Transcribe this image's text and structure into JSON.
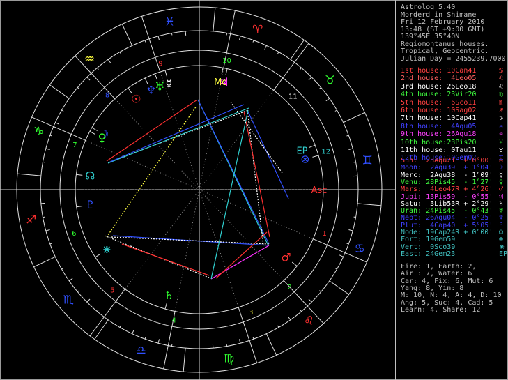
{
  "header": {
    "lines": [
      "Astrolog 5.40",
      "Morderd in Shimane",
      "Fri 12 February 2010",
      "13:48 (ST +9:00 GMT)",
      "139°45E 35°40N",
      "Regiomontanus houses.",
      "Tropical, Geocentric.",
      "Julian Day = 2455239.7000"
    ]
  },
  "houses": [
    {
      "label": "1st house:",
      "value": "10Can41",
      "color": "#ff4040",
      "glyph": "♋"
    },
    {
      "label": "2nd house:",
      "value": " 4Leo05",
      "color": "#ff6060",
      "glyph": "♌"
    },
    {
      "label": "3rd house:",
      "value": "26Leo18",
      "color": "#ffffff",
      "glyph": "♌"
    },
    {
      "label": "4th house:",
      "value": "23Vir20",
      "color": "#40ff40",
      "glyph": "♍"
    },
    {
      "label": "5th house:",
      "value": " 6Sco11",
      "color": "#ff4040",
      "glyph": "♏"
    },
    {
      "label": "6th house:",
      "value": "10Sag02",
      "color": "#ff4040",
      "glyph": "♐"
    },
    {
      "label": "7th house:",
      "value": "10Cap41",
      "color": "#ffffff",
      "glyph": "♑"
    },
    {
      "label": "8th house:",
      "value": " 4Aqu05",
      "color": "#4040ff",
      "glyph": "♒"
    },
    {
      "label": "9th house:",
      "value": "26Aqu18",
      "color": "#ff40ff",
      "glyph": "♒"
    },
    {
      "label": "10th house:",
      "value": "23Pis20",
      "color": "#40ff40",
      "glyph": "♓"
    },
    {
      "label": "11th house:",
      "value": " 0Tau11",
      "color": "#ffffff",
      "glyph": "♉"
    },
    {
      "label": "12th house:",
      "value": "10Gem02",
      "color": "#4040ff",
      "glyph": "♊"
    }
  ],
  "planets": [
    {
      "label": "Sun:",
      "value": "23Aqu21",
      "extra": "+ 0°00'",
      "color": "#ff4040",
      "glyph": "☉"
    },
    {
      "label": "Moon:",
      "value": " 2Aqu39",
      "extra": "+ 1°04'",
      "color": "#4040ff",
      "glyph": "☽"
    },
    {
      "label": "Merc:",
      "value": " 2Aqu38",
      "extra": "- 1°09'",
      "color": "#ffffff",
      "glyph": "☿"
    },
    {
      "label": "Venu:",
      "value": "28Pis45",
      "extra": "- 1°27'",
      "color": "#40ff40",
      "glyph": "♀"
    },
    {
      "label": "Mars:",
      "value": " 4Leo47R",
      "extra": "+ 4°26'",
      "color": "#ff4040",
      "glyph": "♂"
    },
    {
      "label": "Jupi:",
      "value": "13Pis59",
      "extra": "- 0°55'",
      "color": "#ff40ff",
      "glyph": "♃"
    },
    {
      "label": "Satu:",
      "value": " 3Lib53R",
      "extra": "+ 2°29'",
      "color": "#ffffff",
      "glyph": "♄"
    },
    {
      "label": "Uran:",
      "value": "24Pis45",
      "extra": "- 0°43'",
      "color": "#40ff40",
      "glyph": "♅"
    },
    {
      "label": "Nept:",
      "value": "26Aqu04",
      "extra": "- 0°25'",
      "color": "#4040ff",
      "glyph": "♆"
    },
    {
      "label": "Plut:",
      "value": " 4Cap40",
      "extra": "+ 5°05'",
      "color": "#4040ff",
      "glyph": "♇"
    },
    {
      "label": "Node:",
      "value": "19Cap24R",
      "extra": "+ 0°00'",
      "color": "#40c0c0",
      "glyph": "☊"
    },
    {
      "label": "Fort:",
      "value": "19Gem59",
      "extra": "",
      "color": "#40c0c0",
      "glyph": "⊗"
    },
    {
      "label": "Vert:",
      "value": " 0Sco39",
      "extra": "",
      "color": "#40c0c0",
      "glyph": "⋇"
    },
    {
      "label": "East:",
      "value": "24Gem23",
      "extra": "",
      "color": "#40c0c0",
      "glyph": "EP"
    }
  ],
  "summary": [
    "Fire: 1, Earth: 2,",
    "Air : 7, Water: 6",
    "Car: 4, Fix: 6, Mut: 6",
    "Yang: 8, Yin: 8",
    "M: 10, N: 4, A: 4, D: 10",
    "Ang: 5, Suc: 4, Cad: 5",
    "Learn: 4, Share: 12"
  ],
  "colors": {
    "red": "#ff3030",
    "green": "#30ff30",
    "blue": "#3050ff",
    "magenta": "#ff30ff",
    "cyan": "#30d0d0",
    "white": "#ffffff",
    "gray": "#b0b0b0"
  },
  "wheel": {
    "signs": [
      {
        "glyph": "♈",
        "color": "#ff3030",
        "angle": 110
      },
      {
        "glyph": "♉",
        "color": "#30ff30",
        "angle": 140
      },
      {
        "glyph": "♊",
        "color": "#3050ff",
        "angle": 170
      },
      {
        "glyph": "♋",
        "color": "#3050ff",
        "angle": 200
      },
      {
        "glyph": "♌",
        "color": "#ff3030",
        "angle": 230
      },
      {
        "glyph": "♍",
        "color": "#30ff30",
        "angle": 260
      },
      {
        "glyph": "♎",
        "color": "#3050ff",
        "angle": 290
      },
      {
        "glyph": "♏",
        "color": "#3050ff",
        "angle": 320
      },
      {
        "glyph": "♐",
        "color": "#ff3030",
        "angle": 350
      },
      {
        "glyph": "♑",
        "color": "#30ff30",
        "angle": 20
      },
      {
        "glyph": "♒",
        "color": "#ffff40",
        "angle": 50
      },
      {
        "glyph": "♓",
        "color": "#3050ff",
        "angle": 80
      }
    ],
    "house_numbers": [
      {
        "n": "1",
        "color": "#ff3030",
        "angle": 199
      },
      {
        "n": "2",
        "color": "#30ff30",
        "angle": 227
      },
      {
        "n": "3",
        "color": "#ffff40",
        "angle": 247
      },
      {
        "n": "4",
        "color": "#30ff30",
        "angle": 281
      },
      {
        "n": "5",
        "color": "#ff3030",
        "angle": 311
      },
      {
        "n": "6",
        "color": "#30ff30",
        "angle": 341
      },
      {
        "n": "7",
        "color": "#30ff30",
        "angle": 20
      },
      {
        "n": "8",
        "color": "#3050ff",
        "angle": 46
      },
      {
        "n": "9",
        "color": "#ff3030",
        "angle": 73
      },
      {
        "n": "10",
        "color": "#30ff30",
        "angle": 102
      },
      {
        "n": "11",
        "color": "#ffffff",
        "angle": 135
      },
      {
        "n": "12",
        "color": "#30d0d0",
        "angle": 163
      }
    ],
    "cusps": [
      0,
      23.4,
      47.1,
      71.6,
      101.3,
      126.8,
      180,
      203.4,
      227.1,
      251.6,
      281.3,
      306.8
    ],
    "planet_glyphs": [
      {
        "glyph": "☉",
        "color": "#ff3030",
        "angle": 55
      },
      {
        "glyph": "☽",
        "color": "#3050ff",
        "angle": 30
      },
      {
        "glyph": "☿",
        "color": "#ffffff",
        "angle": 74
      },
      {
        "glyph": "♀",
        "color": "#30ff30",
        "angle": 28
      },
      {
        "glyph": "♂",
        "color": "#ff3030",
        "angle": 218
      },
      {
        "glyph": "♃",
        "color": "#ff30ff",
        "angle": 103
      },
      {
        "glyph": "♄",
        "color": "#30ff30",
        "angle": 286
      },
      {
        "glyph": "♅",
        "color": "#30ff30",
        "angle": 69
      },
      {
        "glyph": "♆",
        "color": "#3050ff",
        "angle": 64
      },
      {
        "glyph": "♇",
        "color": "#3050ff",
        "angle": 352
      },
      {
        "glyph": "☊",
        "color": "#30d0d0",
        "angle": 7
      },
      {
        "glyph": "⊗",
        "color": "#3050ff",
        "angle": 164
      },
      {
        "glyph": "⋇",
        "color": "#30d0d0",
        "angle": 327
      },
      {
        "glyph": "EP",
        "color": "#30d0d0",
        "angle": 159
      },
      {
        "glyph": "Asc",
        "color": "#ff3030",
        "angle": 180
      },
      {
        "glyph": "Mc",
        "color": "#ffff40",
        "angle": 101
      }
    ]
  }
}
